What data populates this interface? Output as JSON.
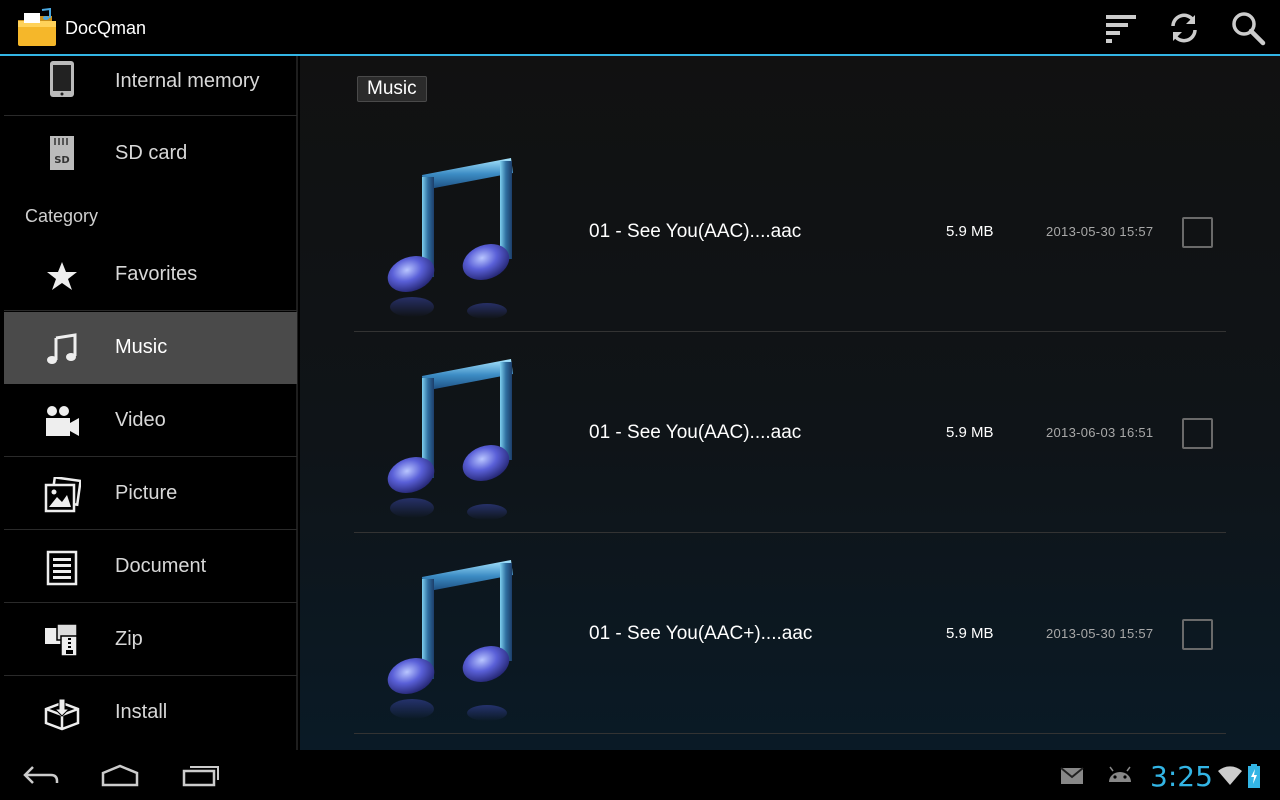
{
  "app": {
    "title": "DocQman"
  },
  "sidebar": {
    "storage": [
      {
        "label": "Internal memory",
        "icon": "phone-icon"
      },
      {
        "label": "SD card",
        "icon": "sd-card-icon"
      }
    ],
    "category_header": "Category",
    "categories": [
      {
        "label": "Favorites",
        "icon": "star-icon"
      },
      {
        "label": "Music",
        "icon": "music-note-icon",
        "selected": true
      },
      {
        "label": "Video",
        "icon": "video-camera-icon"
      },
      {
        "label": "Picture",
        "icon": "picture-icon"
      },
      {
        "label": "Document",
        "icon": "document-icon"
      },
      {
        "label": "Zip",
        "icon": "zip-icon"
      },
      {
        "label": "Install",
        "icon": "install-icon"
      }
    ]
  },
  "main": {
    "breadcrumb": "Music",
    "files": [
      {
        "name": "01 - See You(AAC)....aac",
        "size": "5.9 MB",
        "date": "2013-05-30  15:57",
        "checked": false
      },
      {
        "name": "01 - See You(AAC)....aac",
        "size": "5.9 MB",
        "date": "2013-06-03  16:51",
        "checked": false
      },
      {
        "name": "01 - See You(AAC+)....aac",
        "size": "5.9 MB",
        "date": "2013-05-30  15:57",
        "checked": false
      }
    ]
  },
  "status": {
    "time": "3:25"
  },
  "colors": {
    "accent": "#33b5e5",
    "selected_bg": "#4a4a4a"
  }
}
